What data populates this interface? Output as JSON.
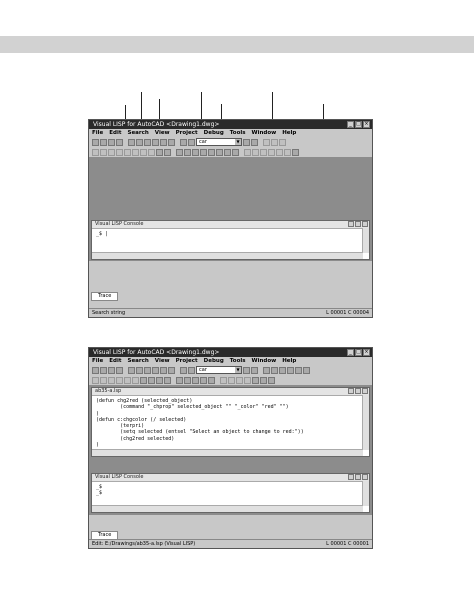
{
  "window1": {
    "title": "Visual LISP for AutoCAD <Drawing1.dwg>",
    "menu": [
      "File",
      "Edit",
      "Search",
      "View",
      "Project",
      "Debug",
      "Tools",
      "Window",
      "Help"
    ],
    "combo_value": "car",
    "console_title": "Visual LISP Console",
    "console_prompt": "_$",
    "trace_tab": "Trace",
    "status_left": "Search string",
    "status_right": "L 00001  C 00004"
  },
  "window2": {
    "title": "Visual LISP for AutoCAD <Drawing1.dwg>",
    "menu": [
      "File",
      "Edit",
      "Search",
      "View",
      "Project",
      "Debug",
      "Tools",
      "Window",
      "Help"
    ],
    "combo_value": "car",
    "editor_title": "ab35-a.lsp",
    "code_lines": [
      "(defun chg2red (selected_object)",
      "        (command \"_chprop\" selected_object \"\" \"_color\" \"red\" \"\")",
      ")",
      "(defun c:chgcolor (/ selected)",
      "        (terpri)",
      "        (setq selected (entsel \"Select an object to change to red:\"))",
      "        (chg2red selected)",
      ")"
    ],
    "console_title": "Visual LISP Console",
    "console_lines": [
      "_$",
      "_$"
    ],
    "trace_tab": "Trace",
    "status_left": "Edit:  E:/Drawings/ab35-a.lsp   (Visual LISP)",
    "status_right": "L 00001  C 00001"
  },
  "icons": {
    "toolbar_icon_name": "toolbar-button-icon",
    "binoculars": "binoculars-icon",
    "combo_arrow": "chevron-down-icon"
  }
}
